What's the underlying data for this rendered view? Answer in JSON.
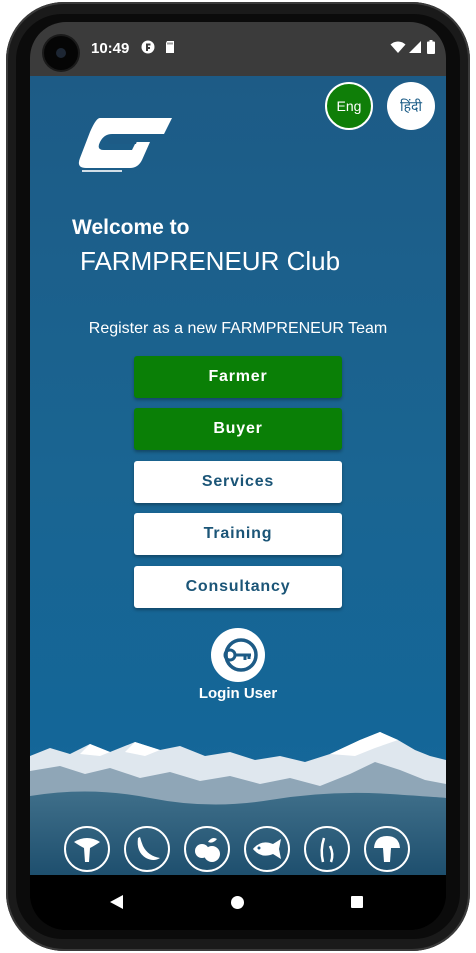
{
  "status_bar": {
    "time": "10:49"
  },
  "language": {
    "english_label": "Eng",
    "hindi_label": "हिंदी"
  },
  "header": {
    "welcome": "Welcome to",
    "club_name": "FARMPRENEUR Club"
  },
  "register_prompt": "Register as a new FARMPRENEUR Team",
  "buttons": {
    "farmer": "Farmer",
    "buyer": "Buyer",
    "services": "Services",
    "training": "Training",
    "consultancy": "Consultancy"
  },
  "login": {
    "label": "Login User"
  },
  "categories": [
    "mushroom-chanterelle-icon",
    "chili-icon",
    "fruits-icon",
    "fish-icon",
    "sprout-icon",
    "mushroom-icon"
  ],
  "colors": {
    "accent_green": "#0a7f06",
    "background_blue": "#1a6592",
    "button_text_blue": "#1b5577"
  }
}
